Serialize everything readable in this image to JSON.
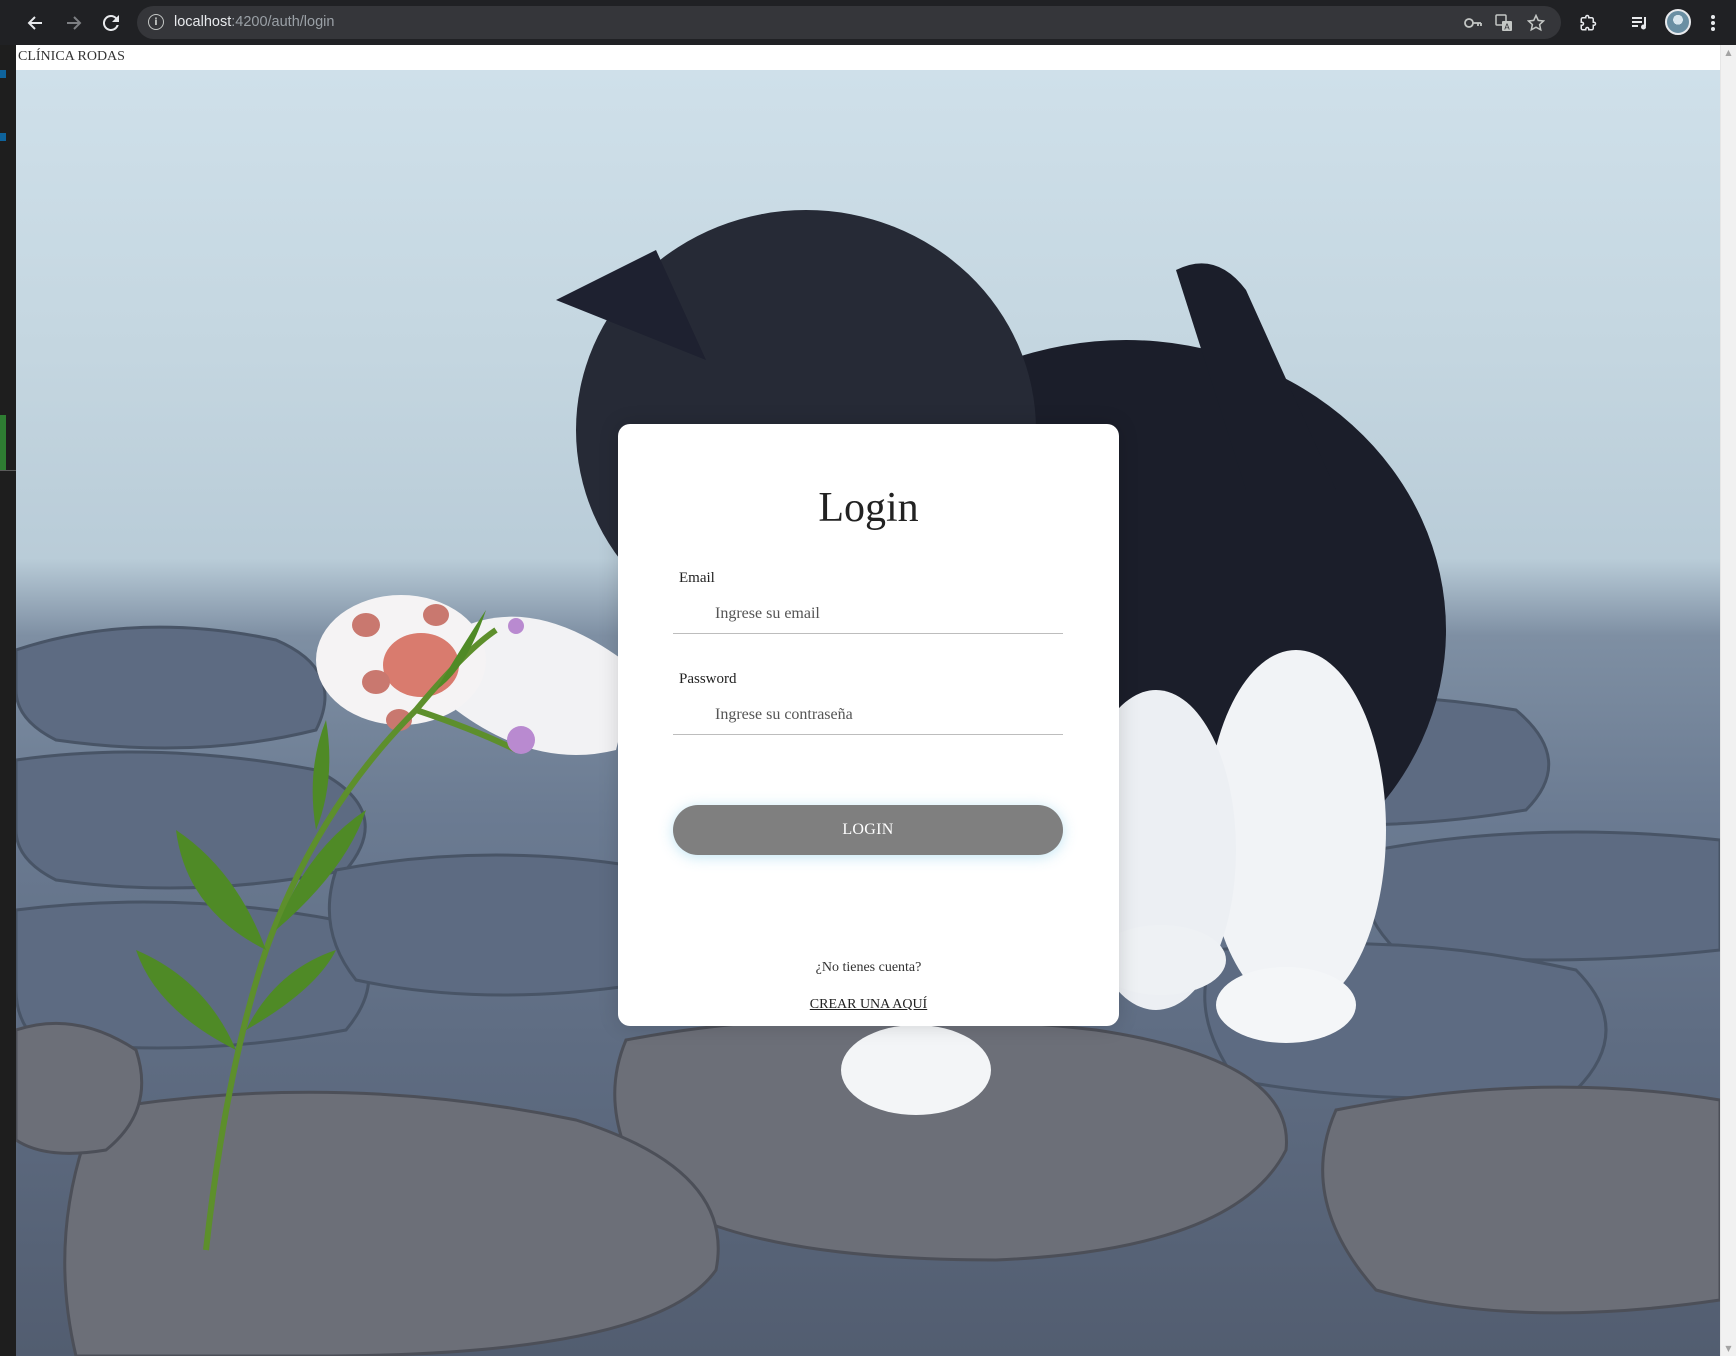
{
  "browser": {
    "url_host": "localhost",
    "url_path": ":4200/auth/login",
    "icons": [
      "back-arrow-icon",
      "forward-arrow-icon",
      "reload-icon",
      "site-info-icon",
      "password-key-icon",
      "translate-icon",
      "bookmark-star-icon",
      "extensions-icon",
      "media-controls-icon",
      "profile-avatar-icon",
      "more-menu-icon"
    ]
  },
  "site": {
    "brand": "CLÍNICA RODAS"
  },
  "login": {
    "title": "Login",
    "email_label": "Email",
    "email_placeholder": "Ingrese su email",
    "password_label": "Password",
    "password_placeholder": "Ingrese su contraseña",
    "submit_label": "LOGIN",
    "no_account_text": "¿No tienes cuenta?",
    "create_link_text": "CREAR UNA AQUÍ"
  },
  "colors": {
    "button_bg": "#7f7f7f",
    "card_bg": "#ffffff",
    "chrome_bg": "#202124"
  }
}
